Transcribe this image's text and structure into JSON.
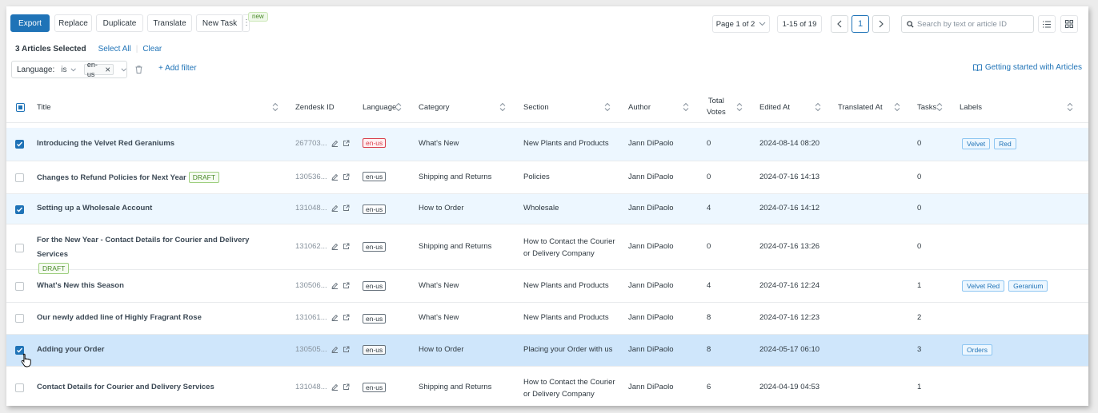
{
  "toolbar": {
    "export_label": "Export",
    "replace_label": "Replace",
    "duplicate_label": "Duplicate",
    "translate_label": "Translate",
    "new_task_label": "New Task",
    "more_label": "⋮",
    "new_badge": "new"
  },
  "pagination": {
    "page_select": "Page 1 of 2",
    "range": "1-15 of 19",
    "current_page": "1"
  },
  "search": {
    "placeholder": "Search by text or article ID"
  },
  "selection": {
    "count_text": "3 Articles Selected",
    "select_all": "Select All",
    "clear": "Clear"
  },
  "filter": {
    "field": "Language:",
    "operator": "is",
    "value": "en-us",
    "add_filter": "+ Add filter"
  },
  "help_link": "Getting started with Articles",
  "columns": {
    "title": "Title",
    "zendesk_id": "Zendesk ID",
    "language": "Language",
    "category": "Category",
    "section": "Section",
    "author": "Author",
    "votes_1": "Total",
    "votes_2": "Votes",
    "edited_at": "Edited At",
    "translated_at": "Translated At",
    "tasks": "Tasks",
    "labels": "Labels"
  },
  "rows": [
    {
      "title": "Introducing the Velvet Red Geraniums",
      "draft": "",
      "id": "267703...",
      "lang": "en-us",
      "category": "What's New",
      "section_1": "New Plants and Products",
      "section_2": "",
      "author": "Jann DiPaolo",
      "votes": "0",
      "edited": "2024-08-14 08:20",
      "tasks": "0",
      "label_1": "Velvet",
      "label_2": "Red"
    },
    {
      "title": "Changes to Refund Policies for Next Year",
      "draft": "DRAFT",
      "id": "130536...",
      "lang": "en-us",
      "category": "Shipping and Returns",
      "section_1": "Policies",
      "section_2": "",
      "author": "Jann DiPaolo",
      "votes": "0",
      "edited": "2024-07-16 14:13",
      "tasks": "0",
      "label_1": "",
      "label_2": ""
    },
    {
      "title": "Setting up a Wholesale Account",
      "draft": "",
      "id": "131048...",
      "lang": "en-us",
      "category": "How to Order",
      "section_1": "Wholesale",
      "section_2": "",
      "author": "Jann DiPaolo",
      "votes": "4",
      "edited": "2024-07-16 14:12",
      "tasks": "0",
      "label_1": "",
      "label_2": ""
    },
    {
      "title": "For the New Year - Contact Details for Courier and Delivery Services",
      "draft": "DRAFT",
      "id": "131062...",
      "lang": "en-us",
      "category": "Shipping and Returns",
      "section_1": "How to Contact the Courier",
      "section_2": "or Delivery Company",
      "author": "Jann DiPaolo",
      "votes": "0",
      "edited": "2024-07-16 13:26",
      "tasks": "0",
      "label_1": "",
      "label_2": ""
    },
    {
      "title": "What's New this Season",
      "draft": "",
      "id": "130506...",
      "lang": "en-us",
      "category": "What's New",
      "section_1": "New Plants and Products",
      "section_2": "",
      "author": "Jann DiPaolo",
      "votes": "4",
      "edited": "2024-07-16 12:24",
      "tasks": "1",
      "label_1": "Velvet Red",
      "label_2": "Geranium"
    },
    {
      "title": "Our newly added line of Highly Fragrant Rose",
      "draft": "",
      "id": "131061...",
      "lang": "en-us",
      "category": "What's New",
      "section_1": "New Plants and Products",
      "section_2": "",
      "author": "Jann DiPaolo",
      "votes": "8",
      "edited": "2024-07-16 12:23",
      "tasks": "2",
      "label_1": "",
      "label_2": ""
    },
    {
      "title": "Adding your Order",
      "draft": "",
      "id": "130505...",
      "lang": "en-us",
      "category": "How to Order",
      "section_1": "Placing your Order with us",
      "section_2": "",
      "author": "Jann DiPaolo",
      "votes": "8",
      "edited": "2024-05-17 06:10",
      "tasks": "3",
      "label_1": "Orders",
      "label_2": ""
    },
    {
      "title": "Contact Details for Courier and Delivery Services",
      "draft": "",
      "id": "131048...",
      "lang": "en-us",
      "category": "Shipping and Returns",
      "section_1": "How to Contact the Courier",
      "section_2": "or Delivery Company",
      "author": "Jann DiPaolo",
      "votes": "6",
      "edited": "2024-04-19 04:53",
      "tasks": "1",
      "label_1": "",
      "label_2": ""
    }
  ],
  "colors": {
    "accent": "#1f73b7",
    "selected_row": "#edf7ff",
    "hover_row": "#cfe6fb",
    "draft_green": "#4a8a2a"
  }
}
